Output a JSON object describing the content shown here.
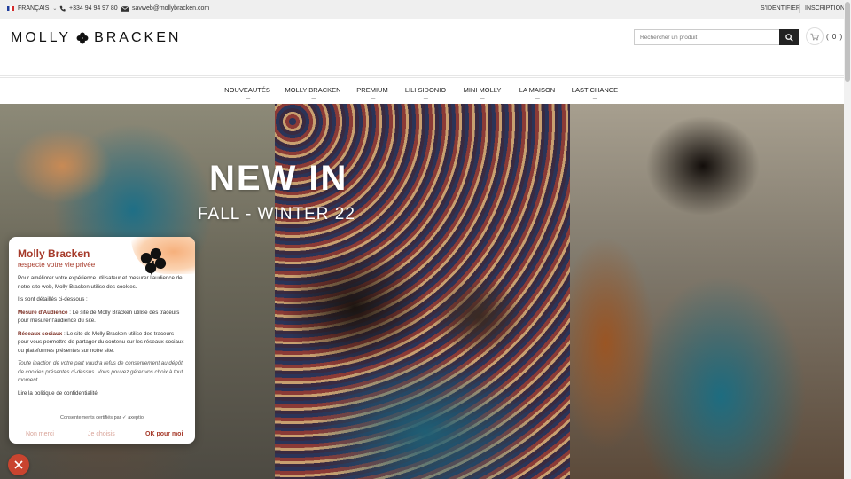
{
  "topbar": {
    "language": "FRANÇAIS",
    "phone": "+334 94 94 97 80",
    "email": "savweb@mollybracken.com",
    "signin": "S'IDENTIFIER",
    "register": "INSCRIPTION"
  },
  "header": {
    "logo_left": "MOLLY",
    "logo_right": "BRACKEN",
    "search_placeholder": "Rechercher un produit",
    "cart_count": "( 0 )"
  },
  "nav": {
    "items": [
      "NOUVEAUTÉS",
      "MOLLY BRACKEN",
      "PREMIUM",
      "LILI SIDONIO",
      "MINI MOLLY",
      "LA MAISON",
      "LAST CHANCE"
    ]
  },
  "hero": {
    "title": "NEW IN",
    "subtitle": "FALL - WINTER 22"
  },
  "consent": {
    "title": "Molly Bracken",
    "subtitle": "respecte votre vie privée",
    "intro": "Pour améliorer votre expérience utilisateur et mesurer l'audience de notre site web, Molly Bracken utilise des cookies.",
    "detail": "Ils sont détaillés ci-dessous :",
    "audience_label": "Mesure d'Audience",
    "audience_text": " : Le site de Molly Bracken utilise des traceurs pour mesurer l'audience du site.",
    "social_label": "Réseaux sociaux",
    "social_text": " : Le site de Molly Bracken utilise des traceurs pour vous permettre de partager du contenu sur les réseaux sociaux ou plateformes présentes sur notre site.",
    "notice": "Toute inaction de votre part vaudra refus de consentement au dépôt de cookies présentés ci-dessus. Vous pouvez gérer vos choix à tout moment.",
    "policy_link": "Lire la politique de confidentialité",
    "certified": "Consentements certifiés par ✓ axeptio",
    "btn_no": "Non merci",
    "btn_choose": "Je choisis",
    "btn_ok": "OK pour moi"
  },
  "colors": {
    "accent": "#a63a2a",
    "fab": "#c9442f",
    "topbar_bg": "#efefef"
  },
  "icons": [
    "phone-icon",
    "mail-icon",
    "search-icon",
    "cart-icon",
    "clover-icon",
    "close-icon",
    "chevron-down-icon"
  ]
}
